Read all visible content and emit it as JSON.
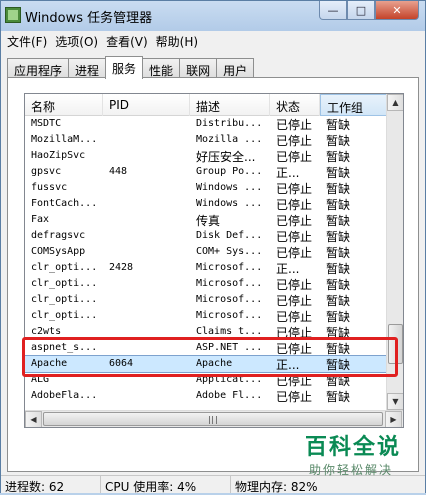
{
  "window": {
    "title": "Windows 任务管理器"
  },
  "titlebar": {
    "minimize": "—",
    "maximize": "□",
    "close": "✕"
  },
  "menu": [
    "文件(F)",
    "选项(O)",
    "查看(V)",
    "帮助(H)"
  ],
  "tabs": [
    "应用程序",
    "进程",
    "服务",
    "性能",
    "联网",
    "用户"
  ],
  "active_tab": "服务",
  "columns": [
    "名称",
    "PID",
    "描述",
    "状态",
    "工作组"
  ],
  "rows": [
    {
      "name": "MSDTC",
      "pid": "",
      "desc": "Distribu...",
      "state": "已停止",
      "group": "暂缺"
    },
    {
      "name": "MozillaM...",
      "pid": "",
      "desc": "Mozilla ...",
      "state": "已停止",
      "group": "暂缺"
    },
    {
      "name": "HaoZipSvc",
      "pid": "",
      "desc": "好压安全...",
      "state": "已停止",
      "group": "暂缺"
    },
    {
      "name": "gpsvc",
      "pid": "448",
      "desc": "Group Po...",
      "state": "正...",
      "group": "暂缺"
    },
    {
      "name": "fussvc",
      "pid": "",
      "desc": "Windows ...",
      "state": "已停止",
      "group": "暂缺"
    },
    {
      "name": "FontCach...",
      "pid": "",
      "desc": "Windows ...",
      "state": "已停止",
      "group": "暂缺"
    },
    {
      "name": "Fax",
      "pid": "",
      "desc": "传真",
      "state": "已停止",
      "group": "暂缺"
    },
    {
      "name": "defragsvc",
      "pid": "",
      "desc": "Disk Def...",
      "state": "已停止",
      "group": "暂缺"
    },
    {
      "name": "COMSysApp",
      "pid": "",
      "desc": "COM+ Sys...",
      "state": "已停止",
      "group": "暂缺"
    },
    {
      "name": "clr_opti...",
      "pid": "2428",
      "desc": "Microsof...",
      "state": "正...",
      "group": "暂缺"
    },
    {
      "name": "clr_opti...",
      "pid": "",
      "desc": "Microsof...",
      "state": "已停止",
      "group": "暂缺"
    },
    {
      "name": "clr_opti...",
      "pid": "",
      "desc": "Microsof...",
      "state": "已停止",
      "group": "暂缺"
    },
    {
      "name": "clr_opti...",
      "pid": "",
      "desc": "Microsof...",
      "state": "已停止",
      "group": "暂缺"
    },
    {
      "name": "c2wts",
      "pid": "",
      "desc": "Claims t...",
      "state": "已停止",
      "group": "暂缺"
    },
    {
      "name": "aspnet_s...",
      "pid": "",
      "desc": "ASP.NET ...",
      "state": "已停止",
      "group": "暂缺"
    },
    {
      "name": "Apache",
      "pid": "6064",
      "desc": "Apache",
      "state": "正...",
      "group": "暂缺",
      "selected": true
    },
    {
      "name": "ALG",
      "pid": "",
      "desc": "Applicat...",
      "state": "已停止",
      "group": "暂缺"
    },
    {
      "name": "AdobeFla...",
      "pid": "",
      "desc": "Adobe Fl...",
      "state": "已停止",
      "group": "暂缺"
    }
  ],
  "status": {
    "processes": "进程数: 62",
    "cpu": "CPU 使用率: 4%",
    "memory": "物理内存: 82%"
  },
  "watermark": {
    "title": "百科全说",
    "subtitle": "助你轻松解决"
  }
}
